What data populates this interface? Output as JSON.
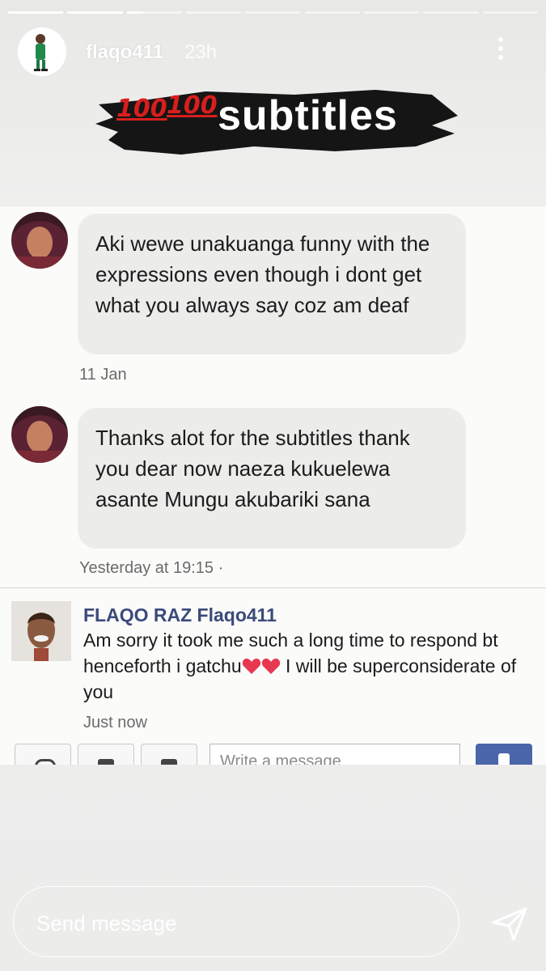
{
  "story": {
    "progress": [
      1,
      1,
      0.3,
      0,
      0,
      0,
      0,
      0,
      0
    ],
    "username": "flaqo411",
    "time": "23h"
  },
  "sticker": {
    "text": "subtitles",
    "emoji_left": "100",
    "emoji_right": "100"
  },
  "messages": [
    {
      "text": "Aki wewe unakuanga funny with the expressions even though i dont get what you always say coz am deaf",
      "stamp": "11 Jan"
    },
    {
      "text": "Thanks alot for the subtitles thank you dear now naeza kukuelewa asante Mungu akubariki sana",
      "stamp": "Yesterday at 19:15 ·"
    }
  ],
  "reply": {
    "name": "FLAQO RAZ Flaqo411",
    "text_before": "Am sorry it took me such a long time to respond bt henceforth i gatchu",
    "text_after": " I will be superconsiderate of you",
    "time": "Just now"
  },
  "composer": {
    "placeholder": "Write a message"
  },
  "story_reply": {
    "placeholder": "Send message"
  },
  "icons": [
    "more-icon",
    "heart-icon",
    "like-icon",
    "send-icon"
  ],
  "colors": {
    "link_name": "#3b4a7a",
    "heart": "#e8384f",
    "like_button": "#4a66a9",
    "emoji_red": "#d81e1e"
  }
}
